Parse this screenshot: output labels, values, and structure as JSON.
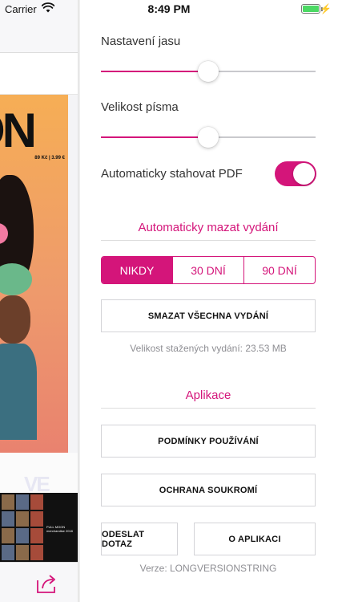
{
  "status_bar": {
    "carrier": "Carrier",
    "time": "8:49 PM"
  },
  "library": {
    "cover_title": "ON",
    "cover_price": "89 Kč | 3.99 €",
    "thumb_caption": "FULL MOON merchandise 2018"
  },
  "settings": {
    "brightness": {
      "label": "Nastavení jasu",
      "value": 0.5
    },
    "font_size": {
      "label": "Velikost písma",
      "value": 0.5
    },
    "auto_download": {
      "label": "Automaticky stahovat PDF",
      "on": true
    },
    "auto_delete": {
      "title": "Automaticky mazat vydání",
      "options": [
        "NIKDY",
        "30 DNÍ",
        "90 DNÍ"
      ],
      "selected": "NIKDY"
    },
    "delete_all_label": "SMAZAT VŠECHNA VYDÁNÍ",
    "downloaded_size": "Velikost stažených vydání: 23.53 MB",
    "app_section": {
      "title": "Aplikace",
      "terms_label": "PODMÍNKY POUŽÍVÁNÍ",
      "privacy_label": "OCHRANA SOUKROMÍ",
      "send_query_label": "ODESLAT DOTAZ",
      "about_label": "O APLIKACI",
      "version": "Verze: LONGVERSIONSTRING"
    }
  },
  "colors": {
    "accent": "#d4157a",
    "track": "#c9c9cd",
    "battery": "#4cd964"
  },
  "icons": [
    "wifi-icon",
    "battery-icon",
    "charging-bolt-icon",
    "share-icon"
  ]
}
